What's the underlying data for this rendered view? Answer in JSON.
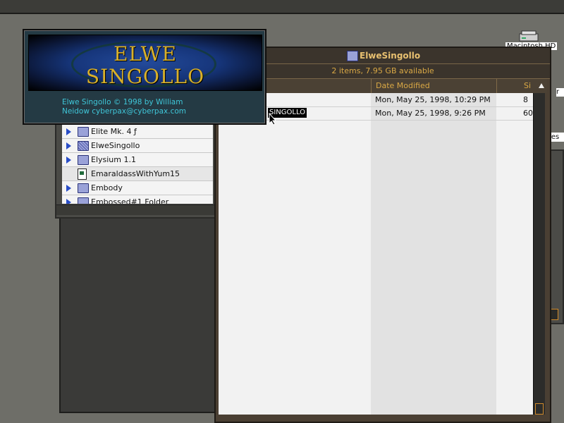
{
  "desktop": {
    "disk_label": "Macintosh HD",
    "stub_r": "r",
    "stub_res": "res"
  },
  "about": {
    "title_line1": "ELWE",
    "title_line2": "SINGOLLO",
    "credit_line1": "Elwe Singollo © 1998 by William",
    "credit_line2": "Neidow cyberpax@cyberpax.com"
  },
  "left_window": {
    "items": [
      {
        "name": "Elite Mk. 4 ƒ",
        "type": "folder"
      },
      {
        "name": "ElweSingollo",
        "type": "folder-textured"
      },
      {
        "name": "Elysium 1.1",
        "type": "folder"
      },
      {
        "name": "EmaraldassWithYum15",
        "type": "document"
      },
      {
        "name": "Embody",
        "type": "folder"
      },
      {
        "name": "Embossed#1 Folder",
        "type": "folder"
      }
    ]
  },
  "main_window": {
    "title": "ElweSingollo",
    "info": "2 items, 7.95 GB available",
    "columns": {
      "date": "Date Modified",
      "size": "Si"
    },
    "rows": [
      {
        "name": "",
        "date": "Mon, May 25, 1998, 10:29 PM",
        "size": "8"
      },
      {
        "name": "SINGOLLO",
        "date": "Mon, May 25, 1998, 9:26 PM",
        "size": "60"
      }
    ]
  },
  "colors": {
    "accent": "#d9a845",
    "credit": "#3fc6d8",
    "title_gold": "#d8b02a"
  }
}
